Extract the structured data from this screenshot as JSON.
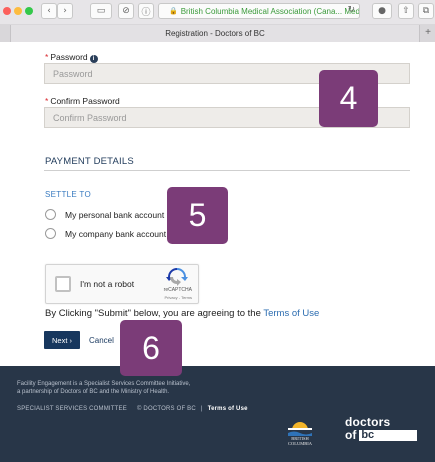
{
  "browser": {
    "address_text": "British Columbia Medical Association (Cana... Medi",
    "tab_title": "Registration - Doctors of BC",
    "buttons": {
      "back": "‹",
      "forward": "›",
      "sidebar": "▭",
      "extension": "⊘",
      "info": "ⓘ",
      "reload": "↻",
      "download": "●",
      "share": "⇧",
      "tabs": "⧉",
      "new_tab": "+"
    }
  },
  "form": {
    "password": {
      "required_mark": "*",
      "label": "Password",
      "info_icon": "i",
      "placeholder": "Password"
    },
    "confirm_password": {
      "required_mark": "*",
      "label": "Confirm Password",
      "placeholder": "Confirm Password"
    },
    "payment_title": "PAYMENT DETAILS",
    "settle_to": "SETTLE TO",
    "options": [
      {
        "label": "My personal bank account"
      },
      {
        "label": "My company bank account"
      }
    ],
    "captcha": {
      "label": "I'm not a robot",
      "brand": "reCAPTCHA",
      "privacy": "Privacy - Terms"
    },
    "terms_prefix": "By Clicking \"Submit\" below, you are agreeing to the",
    "terms_link": "Terms of Use",
    "next_label": "Next ›",
    "cancel_label": "Cancel"
  },
  "footer": {
    "line1": "Facility Engagement is a Specialist Services Committee Initiative,",
    "line2": "a partnership of Doctors of BC and the Ministry of Health.",
    "link1": "SPECIALIST SERVICES COMMITTEE",
    "copyright": "© DOCTORS OF BC",
    "separator": "|",
    "terms": "Terms of Use",
    "bc_logo_text_1": "BRITISH",
    "bc_logo_text_2": "COLUMBIA",
    "dbc_top": "doctors",
    "dbc_of": "of",
    "dbc_bc": "bc"
  },
  "badges": {
    "step4": "4",
    "step5": "5",
    "step6": "6"
  },
  "colors": {
    "badge": "#7b3c78",
    "footer": "#283648",
    "primary_button": "#17375e",
    "link": "#2b6cb0",
    "required": "#d9272e"
  }
}
